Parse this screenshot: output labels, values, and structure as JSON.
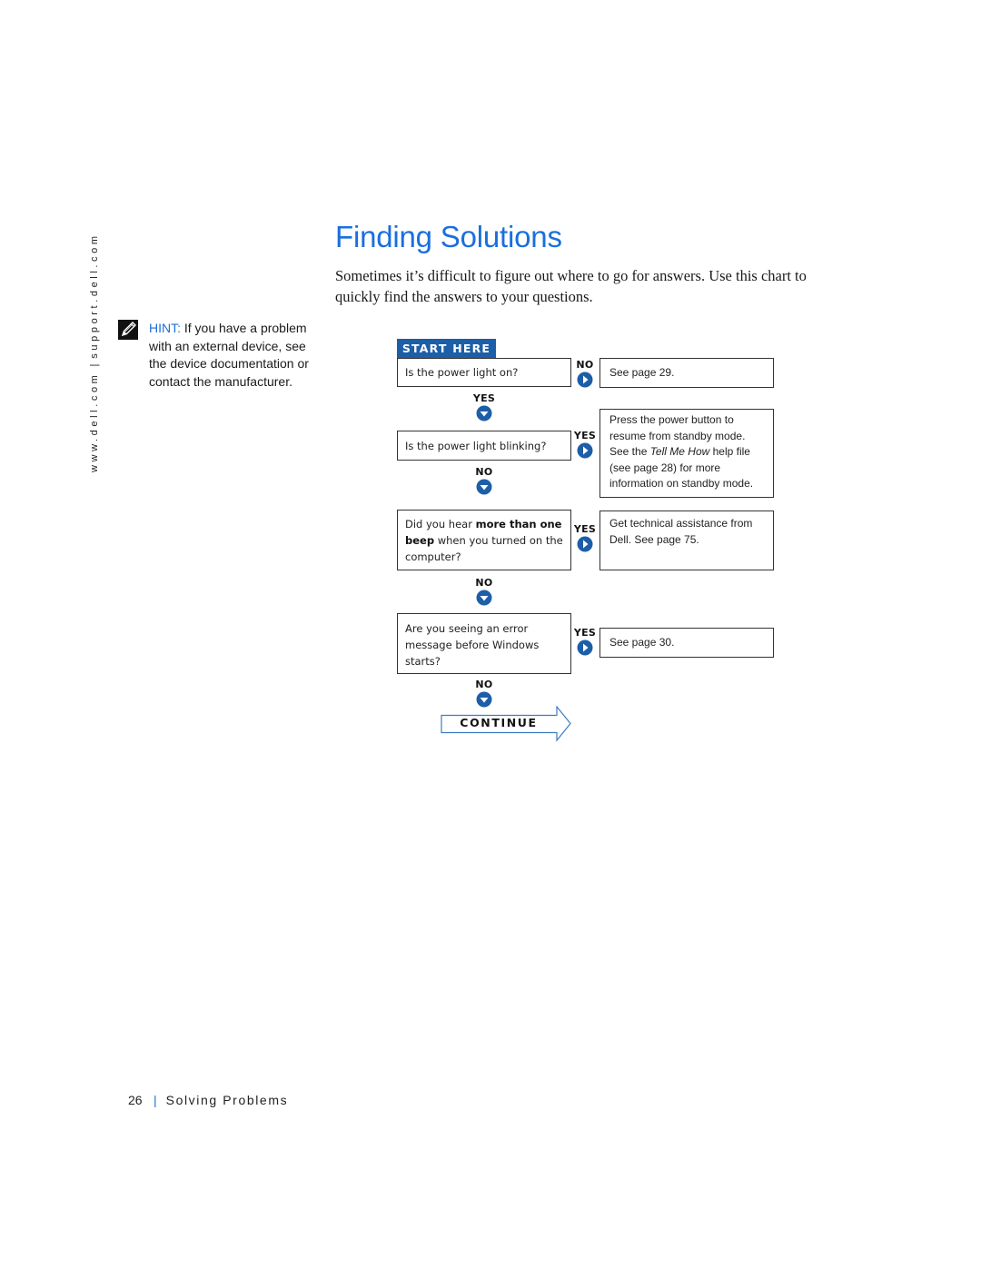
{
  "sidebar": {
    "url_left": "www.dell.com",
    "url_sep": "|",
    "url_right": "support.dell.com"
  },
  "hint": {
    "icon": "pencil-note-icon",
    "label": "HINT:",
    "text": " If you have a problem with an external device, see the device documentation or contact the manufacturer."
  },
  "page": {
    "title": "Finding Solutions",
    "intro": "Sometimes it’s difficult to figure out where to go for answers. Use this chart to quickly find the answers to your questions."
  },
  "flowchart": {
    "start_label": "START HERE",
    "colors": {
      "accent": "#1d5ea8",
      "title": "#1a6fde"
    },
    "questions": [
      {
        "text": "Is the power light on?"
      },
      {
        "text": "Is the power light blinking?"
      },
      {
        "pre": "Did you hear ",
        "bold1": "more than one",
        "mid": " ",
        "bold2": "beep",
        "post": " when you turned on the computer?"
      },
      {
        "text": "Are you seeing an error message before Windows starts?"
      }
    ],
    "answers": [
      {
        "text": "See page 29."
      },
      {
        "pre": "Press the power button to resume from standby mode. See the ",
        "italic": "Tell Me How",
        "post": " help file (see page 28) for more information on standby mode."
      },
      {
        "text": "Get technical assistance from Dell. See page 75."
      },
      {
        "text": "See page 30."
      }
    ],
    "connectors": {
      "q1_right": "NO",
      "q1_down": "YES",
      "q2_right": "YES",
      "q2_down": "NO",
      "q3_right": "YES",
      "q3_down": "NO",
      "q4_right": "YES",
      "q4_down": "NO"
    },
    "continue_label": "CONTINUE"
  },
  "footer": {
    "page_number": "26",
    "separator": "|",
    "section": "Solving Problems"
  }
}
